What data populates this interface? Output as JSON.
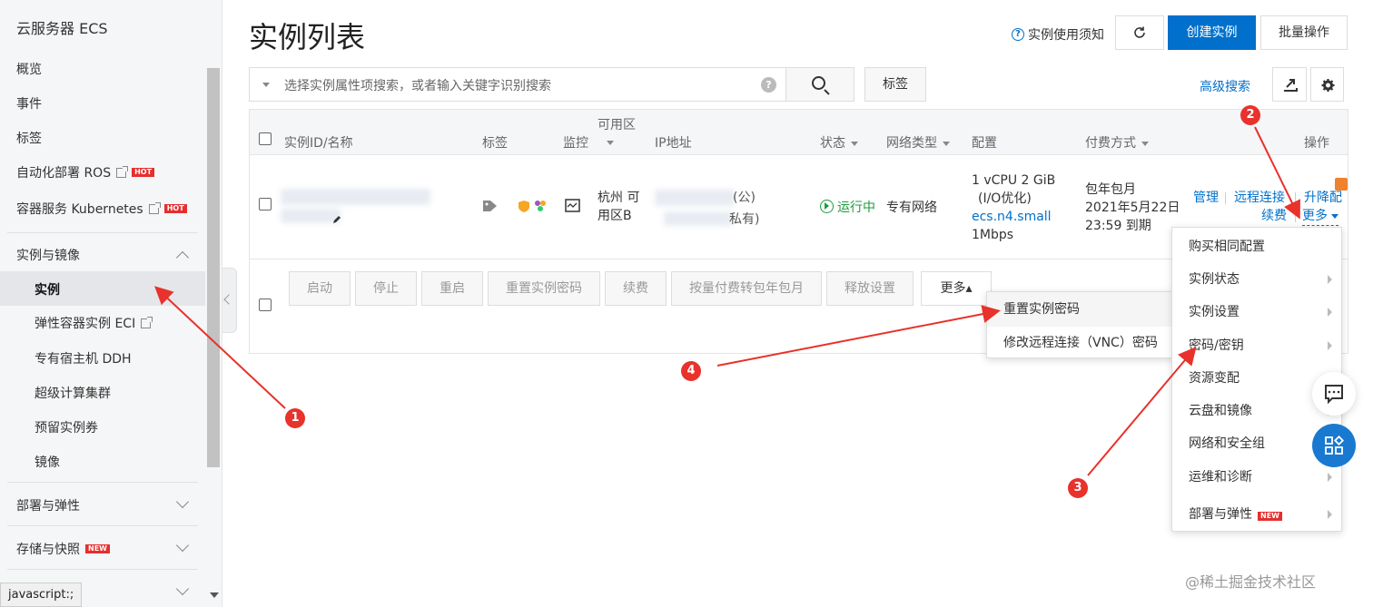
{
  "sidebar": {
    "title": "云服务器 ECS",
    "items": [
      {
        "label": "概览"
      },
      {
        "label": "事件"
      },
      {
        "label": "标签"
      },
      {
        "label": "自动化部署 ROS",
        "badge": "HOT"
      },
      {
        "label": "容器服务 Kubernetes",
        "badge": "HOT"
      }
    ],
    "group_instances": "实例与镜像",
    "sub_items": [
      {
        "label": "实例"
      },
      {
        "label": "弹性容器实例 ECI"
      },
      {
        "label": "专有宿主机 DDH"
      },
      {
        "label": "超级计算集群"
      },
      {
        "label": "预留实例券"
      },
      {
        "label": "镜像"
      }
    ],
    "group_deploy": "部署与弹性",
    "group_storage": "存储与快照",
    "storage_badge": "NEW"
  },
  "status_url": "javascript:;",
  "header": {
    "title": "实例列表",
    "notice": "实例使用须知",
    "create": "创建实例",
    "batch": "批量操作"
  },
  "search": {
    "placeholder": "选择实例属性项搜索，或者输入关键字识别搜索",
    "help": "?",
    "tag": "标签",
    "advanced": "高级搜索"
  },
  "table": {
    "headers": {
      "id": "实例ID/名称",
      "tag": "标签",
      "monitor": "监控",
      "zone": "可用区",
      "ip": "IP地址",
      "status": "状态",
      "network": "网络类型",
      "config": "配置",
      "billing": "付费方式",
      "actions": "操作"
    },
    "row": {
      "zone_line1": "杭州 可",
      "zone_line2": "用区B",
      "ip_public": "(公)",
      "ip_private": "私有)",
      "status": "运行中",
      "network": "专有网络",
      "config_line1": "1 vCPU 2 GiB",
      "config_line2": "(I/O优化)",
      "config_line3": "ecs.n4.small",
      "config_line4": "1Mbps",
      "billing_line1": "包年包月",
      "billing_line2": "2021年5月22日",
      "billing_line3": "23:59 到期",
      "action_manage": "管理",
      "action_remote": "远程连接",
      "action_resize": "升降配",
      "action_renew": "续费",
      "action_more": "更多"
    }
  },
  "bulk": {
    "start": "启动",
    "stop": "停止",
    "restart": "重启",
    "reset_pwd": "重置实例密码",
    "renew": "续费",
    "convert": "按量付费转包年包月",
    "release": "释放设置",
    "more": "更多▴"
  },
  "bulk_more_menu": [
    "重置实例密码",
    "修改远程连接（VNC）密码"
  ],
  "more_menu": [
    {
      "label": "购买相同配置",
      "sub": false
    },
    {
      "label": "实例状态",
      "sub": true
    },
    {
      "label": "实例设置",
      "sub": true
    },
    {
      "label": "密码/密钥",
      "sub": true
    },
    {
      "label": "资源变配",
      "sub": true
    },
    {
      "label": "云盘和镜像",
      "sub": true
    },
    {
      "label": "网络和安全组",
      "sub": true
    },
    {
      "label": "运维和诊断",
      "sub": true
    },
    {
      "label": "部署与弹性",
      "sub": true,
      "badge": "NEW"
    }
  ],
  "annotations": [
    "1",
    "2",
    "3",
    "4"
  ],
  "watermark": "@稀土掘金技术社区",
  "colors": {
    "primary": "#0070cc",
    "running": "#1d9c3c",
    "hot": "#e62e2e",
    "annotation": "#e8322b"
  }
}
